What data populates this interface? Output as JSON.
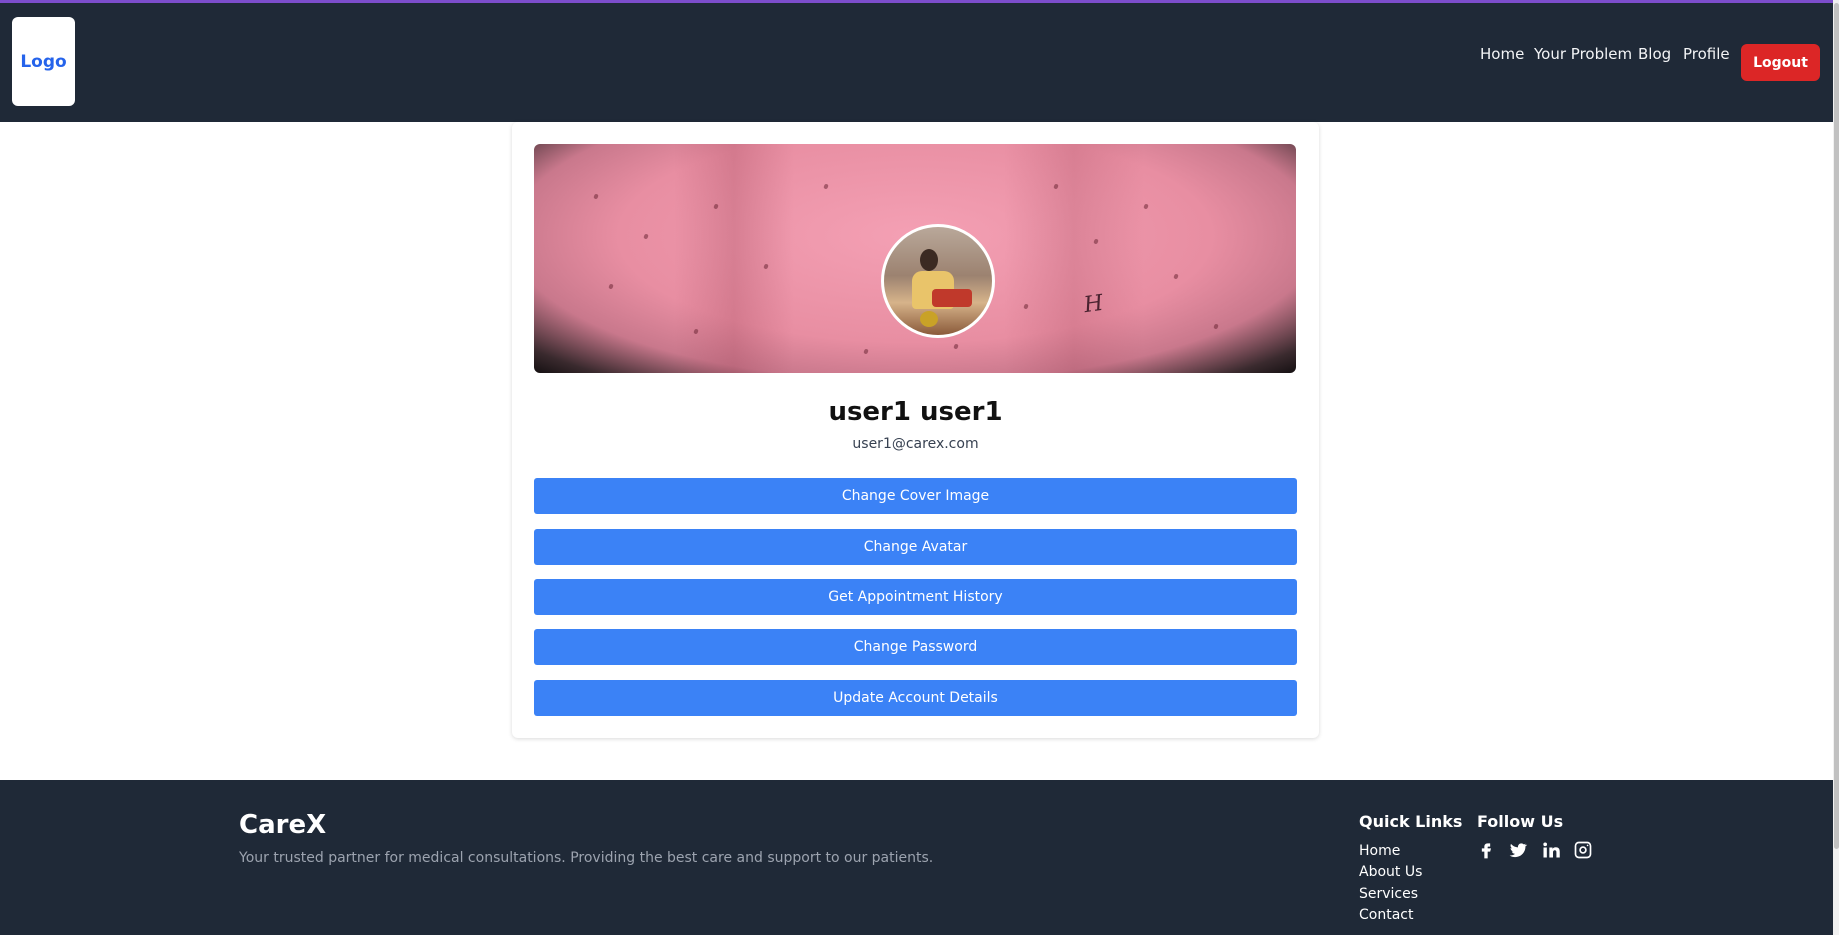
{
  "header": {
    "logo_text": "Logo",
    "nav": [
      {
        "label": "Home"
      },
      {
        "label": "Your Problem"
      },
      {
        "label": "Blog"
      },
      {
        "label": "Profile"
      }
    ],
    "logout_label": "Logout"
  },
  "profile": {
    "full_name": "user1 user1",
    "email": "user1@carex.com",
    "actions": [
      {
        "label": "Change Cover Image"
      },
      {
        "label": "Change Avatar"
      },
      {
        "label": "Get Appointment History"
      },
      {
        "label": "Change Password"
      },
      {
        "label": "Update Account Details"
      }
    ]
  },
  "footer": {
    "brand": "CareX",
    "tagline": "Your trusted partner for medical consultations. Providing the best care and support to our patients.",
    "quick_links_title": "Quick Links",
    "quick_links": [
      {
        "label": "Home"
      },
      {
        "label": "About Us"
      },
      {
        "label": "Services"
      },
      {
        "label": "Contact"
      }
    ],
    "follow_title": "Follow Us",
    "social_icons": [
      "facebook-icon",
      "twitter-icon",
      "linkedin-icon",
      "instagram-icon"
    ]
  },
  "colors": {
    "header_bg": "#1f2937",
    "accent_line": "#7c4dcc",
    "primary_button": "#3b82f6",
    "logout_button": "#dc2626",
    "logo_text": "#2563eb"
  }
}
